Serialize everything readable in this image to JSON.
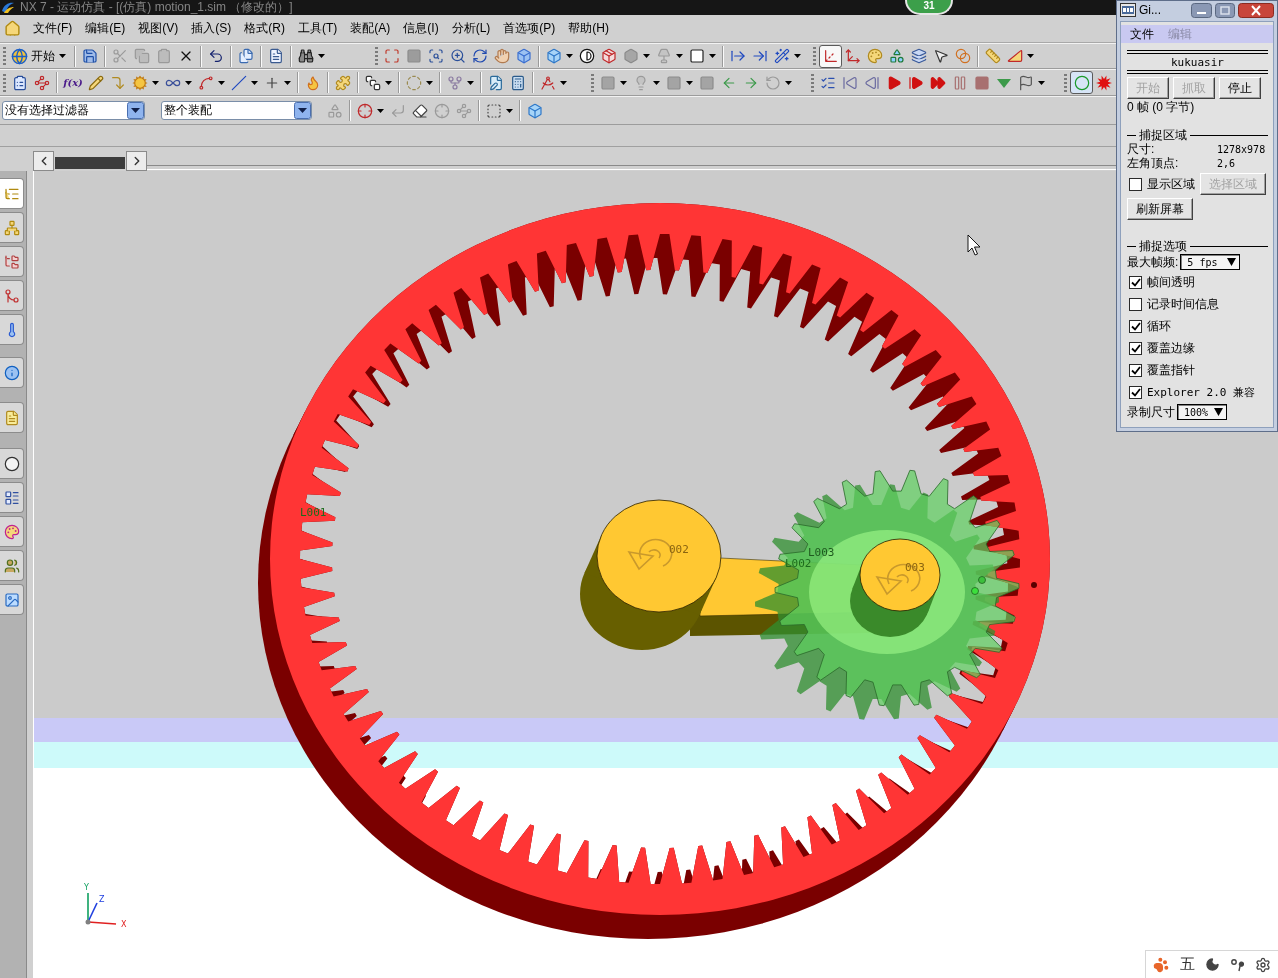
{
  "title_bar": {
    "title": "NX 7 - 运动仿真 - [(仿真) motion_1.sim （修改的）]",
    "badge": "31"
  },
  "menu_bar": {
    "items": [
      "文件(F)",
      "编辑(E)",
      "视图(V)",
      "插入(S)",
      "格式(R)",
      "工具(T)",
      "装配(A)",
      "信息(I)",
      "分析(L)",
      "首选项(P)",
      "帮助(H)"
    ]
  },
  "toolbar_1": {
    "start_button": "开始",
    "axes_tool_on": true
  },
  "toolbar_2": {
    "formula_button": "f(x)",
    "ring_tool_on": true
  },
  "selection_bar": {
    "filter": "没有选择过滤器",
    "scope": "整个装配"
  },
  "resource_tabs": [
    {
      "selected": true
    },
    {
      "selected": false
    },
    {
      "selected": false
    },
    {
      "selected": false
    },
    {
      "selected": false
    },
    {
      "selected": false
    },
    {
      "selected": false
    },
    {
      "selected": false
    },
    {
      "selected": false
    },
    {
      "selected": false
    },
    {
      "selected": false
    },
    {
      "selected": false
    }
  ],
  "viewport": {
    "labels": [
      {
        "text": "L001"
      },
      {
        "text": "002"
      },
      {
        "text": "L003"
      },
      {
        "text": "L002"
      },
      {
        "text": "003"
      }
    ],
    "axes": [
      "Y",
      "Z",
      "X"
    ]
  },
  "capture_window": {
    "title": "Gi...",
    "menu": [
      {
        "label": "文件",
        "disabled": false
      },
      {
        "label": "编辑",
        "disabled": true
      }
    ],
    "banner": "kukuasir",
    "buttons": [
      {
        "label": "开始",
        "disabled": true
      },
      {
        "label": "抓取",
        "disabled": true
      },
      {
        "label": "停止",
        "disabled": false
      }
    ],
    "status": "0 帧 (0 字节)",
    "area_section": {
      "title": "捕捉区域",
      "size_label": "尺寸:",
      "size_value": "1278x978",
      "corner_label": "左角顶点:",
      "corner_value": "2,6",
      "show_area": {
        "label": "显示区域",
        "checked": false
      },
      "select_button": {
        "label": "选择区域",
        "disabled": true
      },
      "refresh_button": "刷新屏幕"
    },
    "options_section": {
      "title": "捕捉选项",
      "max_rate_label": "最大帧频:",
      "max_rate": "5 fps",
      "options": [
        {
          "label": "帧间透明",
          "checked": true
        },
        {
          "label": "记录时间信息",
          "checked": false
        },
        {
          "label": "循环",
          "checked": true
        },
        {
          "label": "覆盖边缘",
          "checked": true
        },
        {
          "label": "覆盖指针",
          "checked": true
        },
        {
          "label": "Explorer 2.0 兼容",
          "checked": true
        }
      ],
      "record_size_label": "录制尺寸",
      "record_size": "100%"
    }
  },
  "tray": {
    "ime": "五"
  }
}
